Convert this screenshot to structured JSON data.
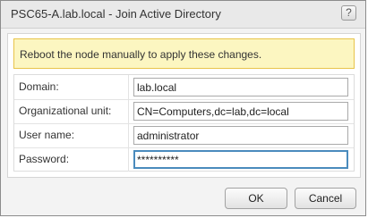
{
  "dialog": {
    "title": "PSC65-A.lab.local - Join Active Directory",
    "help_label": "?"
  },
  "warning": {
    "text": "Reboot the node manually to apply these changes."
  },
  "form": {
    "domain": {
      "label": "Domain:",
      "value": "lab.local"
    },
    "ou": {
      "label": "Organizational unit:",
      "value": "CN=Computers,dc=lab,dc=local"
    },
    "username": {
      "label": "User name:",
      "value": "administrator"
    },
    "password": {
      "label": "Password:",
      "value": "**********"
    }
  },
  "buttons": {
    "ok": "OK",
    "cancel": "Cancel"
  },
  "colors": {
    "warning_bg": "#fcf6c1",
    "warning_border": "#e8c44a",
    "focus_border": "#4a8bbd"
  }
}
